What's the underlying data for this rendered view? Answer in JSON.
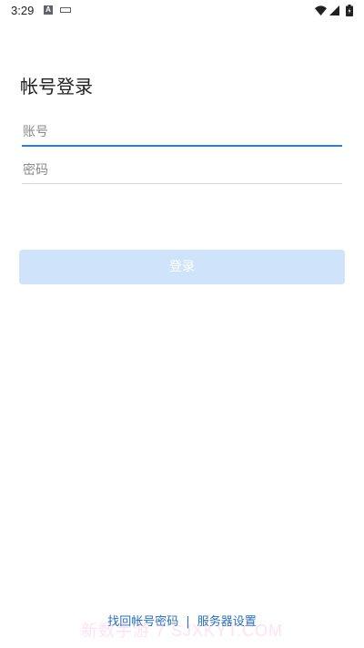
{
  "status_bar": {
    "time": "3:29",
    "icons": [
      "a-notification-icon",
      "keyboard-icon",
      "wifi-icon",
      "signal-icon",
      "battery-icon"
    ]
  },
  "page": {
    "title": "帐号登录"
  },
  "form": {
    "account_value": "",
    "account_placeholder": "账号",
    "password_value": "",
    "password_placeholder": "密码",
    "login_label": "登录"
  },
  "footer": {
    "recover_label": "找回帐号密码",
    "separator": "|",
    "server_settings_label": "服务器设置"
  },
  "watermark": {
    "text": "新数手游 7 SJXKYT.COM"
  },
  "colors": {
    "accent": "#2a7fd6",
    "link": "#2a6fb8",
    "button_disabled": "#cfe3fb",
    "divider": "#d9d9d9"
  }
}
